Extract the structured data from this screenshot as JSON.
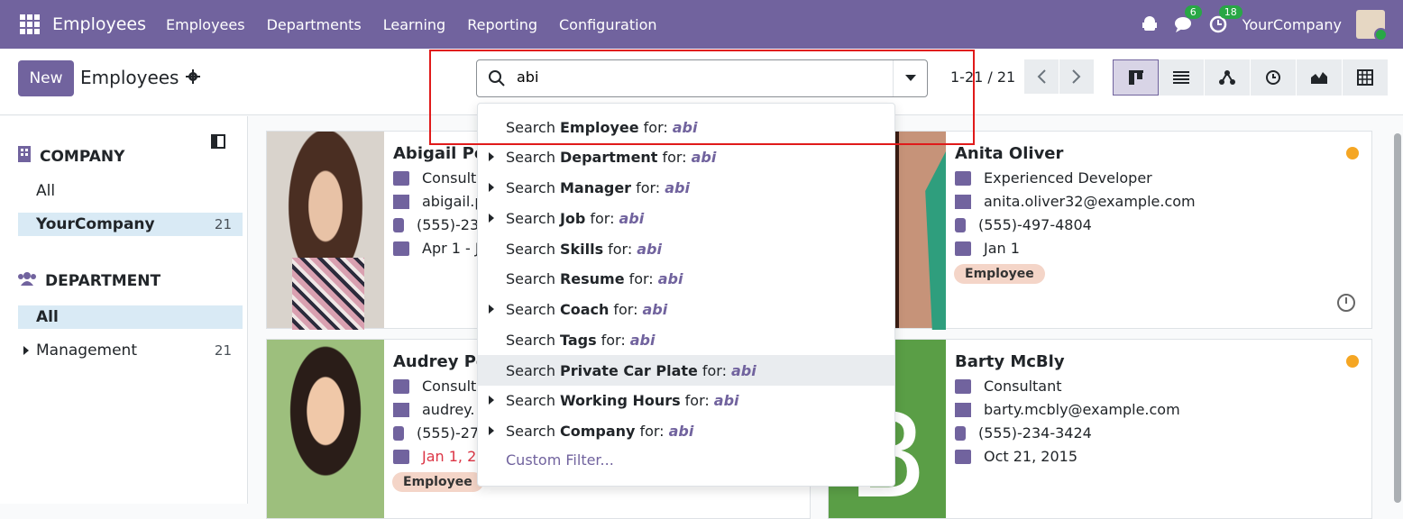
{
  "app": {
    "brand": "Employees"
  },
  "topnav": [
    "Employees",
    "Departments",
    "Learning",
    "Reporting",
    "Configuration"
  ],
  "topright": {
    "chat_count": "6",
    "activity_count": "18",
    "company": "YourCompany"
  },
  "control": {
    "new_label": "New",
    "breadcrumb": "Employees",
    "search_value": "abi",
    "pager": "1-21 / 21"
  },
  "sidebar": {
    "company_head": "COMPANY",
    "company_items": [
      {
        "label": "All",
        "count": ""
      },
      {
        "label": "YourCompany",
        "count": "21"
      }
    ],
    "department_head": "DEPARTMENT",
    "department_items": [
      {
        "label": "All",
        "count": ""
      },
      {
        "label": "Management",
        "count": "21"
      }
    ]
  },
  "cards": [
    {
      "name": "Abigail Pe",
      "job": "Consult",
      "email": "abigail.p",
      "phone": "(555)-23",
      "date": "Apr 1 - J"
    },
    {
      "name": "Anita Oliver",
      "job": "Experienced Developer",
      "email": "anita.oliver32@example.com",
      "phone": "(555)-497-4804",
      "date": "Jan 1",
      "tag": "Employee"
    },
    {
      "name": "Audrey Pe",
      "job": "Consult",
      "email": "audrey.",
      "phone": "(555)-27",
      "date": "Jan 1, 2",
      "tag": "Employee"
    },
    {
      "name": "Barty McBly",
      "job": "Consultant",
      "email": "barty.mcbly@example.com",
      "phone": "(555)-234-3424",
      "date": "Oct 21, 2015",
      "initial": "B"
    }
  ],
  "dropdown": {
    "prefix": "Search",
    "for": "for:",
    "query": "abi",
    "items": [
      {
        "field": "Employee",
        "caret": false
      },
      {
        "field": "Department",
        "caret": true
      },
      {
        "field": "Manager",
        "caret": true
      },
      {
        "field": "Job",
        "caret": true
      },
      {
        "field": "Skills",
        "caret": false
      },
      {
        "field": "Resume",
        "caret": false
      },
      {
        "field": "Coach",
        "caret": true
      },
      {
        "field": "Tags",
        "caret": false
      },
      {
        "field": "Private Car Plate",
        "caret": false
      },
      {
        "field": "Working Hours",
        "caret": true
      },
      {
        "field": "Company",
        "caret": true
      }
    ],
    "custom": "Custom Filter..."
  },
  "colors": {
    "brand": "#71639e",
    "highlight_frame": "#e01a1a",
    "status": "#f5a623"
  }
}
